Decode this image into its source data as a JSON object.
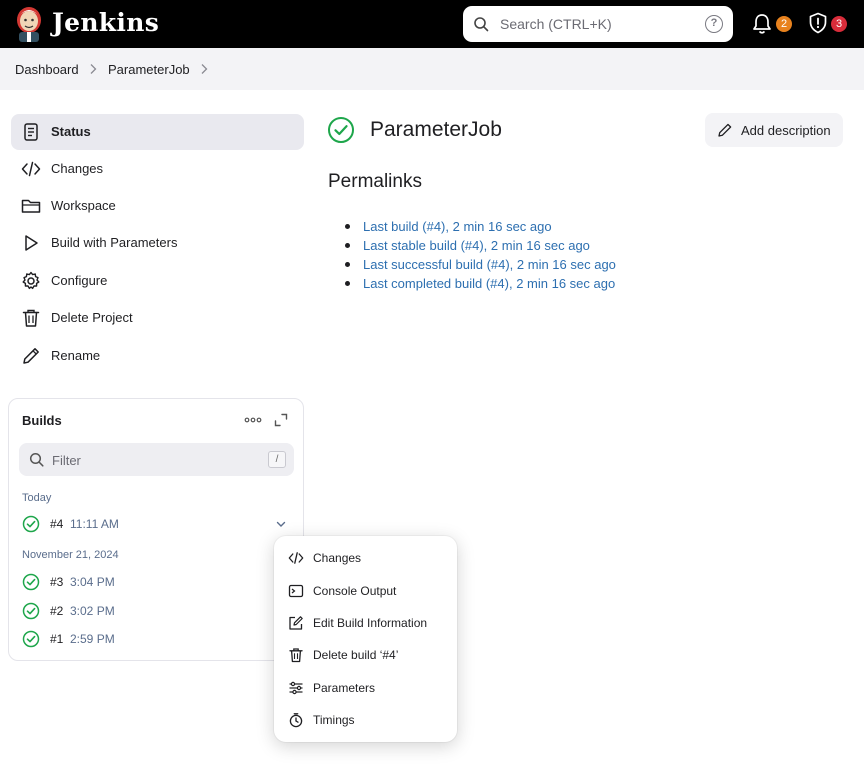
{
  "header": {
    "brand": "Jenkins",
    "search_placeholder": "Search (CTRL+K)",
    "help_glyph": "?",
    "notifications_count": "2",
    "security_count": "3",
    "colors": {
      "background": "#000000",
      "notifications_badge": "#e8821e",
      "security_badge": "#d92c3a"
    }
  },
  "breadcrumb": {
    "items": [
      {
        "label": "Dashboard"
      },
      {
        "label": "ParameterJob"
      }
    ]
  },
  "sidebar": {
    "items": [
      {
        "label": "Status",
        "icon": "status-doc-icon",
        "active": true
      },
      {
        "label": "Changes",
        "icon": "code-icon"
      },
      {
        "label": "Workspace",
        "icon": "folder-icon"
      },
      {
        "label": "Build with Parameters",
        "icon": "play-icon"
      },
      {
        "label": "Configure",
        "icon": "gear-icon"
      },
      {
        "label": "Delete Project",
        "icon": "trash-icon"
      },
      {
        "label": "Rename",
        "icon": "pencil-icon"
      }
    ]
  },
  "builds": {
    "title": "Builds",
    "filter_placeholder": "Filter",
    "filter_shortcut": "/",
    "groups": [
      {
        "date": "Today",
        "builds": [
          {
            "number": "#4",
            "time": "11:11 AM"
          }
        ]
      },
      {
        "date": "November 21, 2024",
        "builds": [
          {
            "number": "#3",
            "time": "3:04 PM"
          },
          {
            "number": "#2",
            "time": "3:02 PM"
          },
          {
            "number": "#1",
            "time": "2:59 PM"
          }
        ]
      }
    ]
  },
  "main": {
    "job_title": "ParameterJob",
    "add_description_label": "Add description",
    "permalinks_title": "Permalinks",
    "permalinks": [
      "Last build (#4), 2 min 16 sec ago",
      "Last stable build (#4), 2 min 16 sec ago",
      "Last successful build (#4), 2 min 16 sec ago",
      "Last completed build (#4), 2 min 16 sec ago"
    ],
    "colors": {
      "success": "#1ea64b",
      "link": "#2d6fb0"
    }
  },
  "build_menu": {
    "items": [
      {
        "label": "Changes",
        "icon": "code-icon"
      },
      {
        "label": "Console Output",
        "icon": "terminal-icon"
      },
      {
        "label": "Edit Build Information",
        "icon": "edit-icon"
      },
      {
        "label": "Delete build ‘#4’",
        "icon": "trash-icon"
      },
      {
        "label": "Parameters",
        "icon": "sliders-icon"
      },
      {
        "label": "Timings",
        "icon": "stopwatch-icon"
      }
    ]
  }
}
